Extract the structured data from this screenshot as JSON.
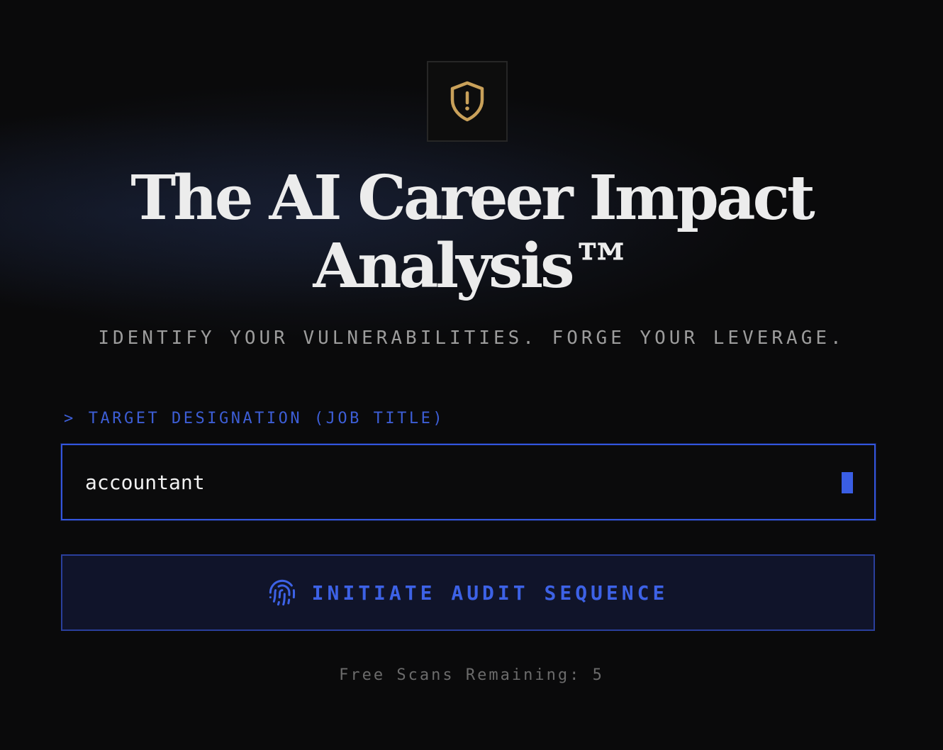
{
  "logo": {
    "icon": "shield-alert-icon",
    "color": "#c9a15a"
  },
  "header": {
    "title_line1": "The AI Career Impact",
    "title_line2": "Analysis™",
    "subtitle": "IDENTIFY YOUR VULNERABILITIES. FORGE YOUR LEVERAGE."
  },
  "form": {
    "label_prefix": ">",
    "label": "TARGET DESIGNATION (JOB TITLE)",
    "job_title_value": "accountant",
    "accent": "#3d5ed6"
  },
  "action": {
    "icon": "fingerprint-icon",
    "label": "INITIATE AUDIT SEQUENCE"
  },
  "footer": {
    "scans_remaining": "Free Scans Remaining: 5"
  }
}
